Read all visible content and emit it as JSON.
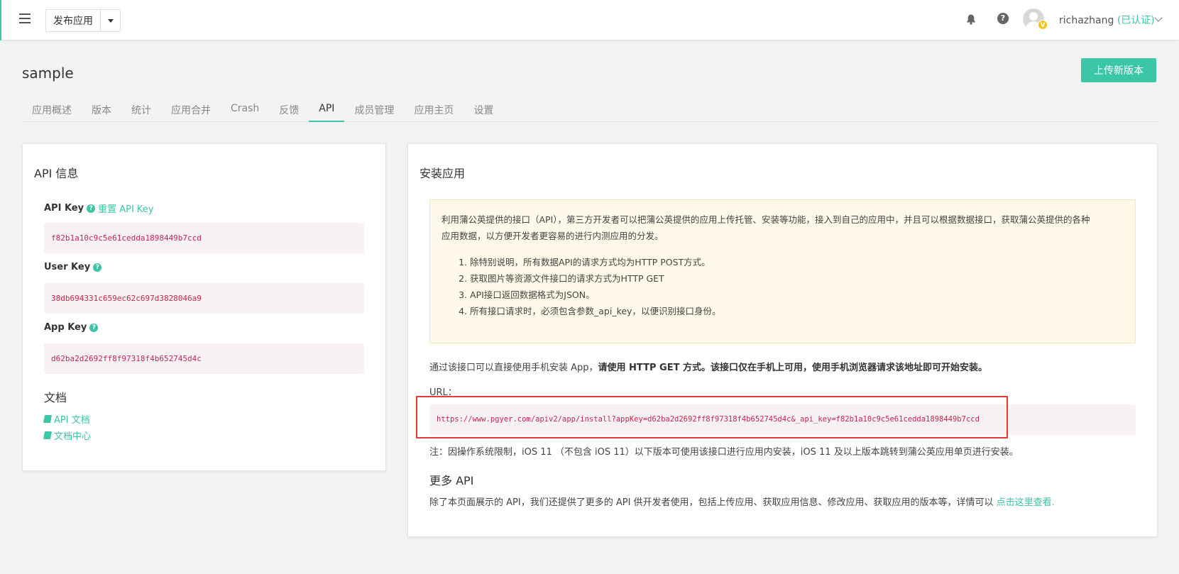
{
  "topbar": {
    "app_select_label": "发布应用",
    "username": "richazhang",
    "verified": "(已认证)",
    "avatar_badge": "V",
    "help_glyph": "?"
  },
  "header": {
    "title": "sample",
    "upload_button": "上传新版本"
  },
  "tabs": [
    {
      "label": "应用概述"
    },
    {
      "label": "版本"
    },
    {
      "label": "统计"
    },
    {
      "label": "应用合并"
    },
    {
      "label": "Crash"
    },
    {
      "label": "反馈"
    },
    {
      "label": "API",
      "active": true
    },
    {
      "label": "成员管理"
    },
    {
      "label": "应用主页"
    },
    {
      "label": "设置"
    }
  ],
  "api_info": {
    "title": "API 信息",
    "api_key_label": "API Key",
    "reset_link": "重置 API Key",
    "api_key_value": "f82b1a10c9c5e61cedda1898449b7ccd",
    "user_key_label": "User Key",
    "user_key_value": "38db694331c659ec62c697d3828046a9",
    "app_key_label": "App Key",
    "app_key_value": "d62ba2d2692ff8f97318f4b652745d4c",
    "docs_title": "文档",
    "doc_link_1": "API 文档",
    "doc_link_2": "文档中心"
  },
  "install": {
    "title": "安装应用",
    "intro_line1": "利用蒲公英提供的接口（API），第三方开发者可以把蒲公英提供的应用上传托管、安装等功能，接入到自己的应用中，并且可以根据数据接口，获取蒲公英提供的各种",
    "intro_line2": "应用数据，以方便开发者更容易的进行内测应用的分发。",
    "rules": [
      "除特别说明，所有数据API的请求方式均为HTTP POST方式。",
      "获取图片等资源文件接口的请求方式为HTTP GET",
      "API接口返回数据格式为JSON。",
      "所有接口请求时，必须包含参数_api_key，以便识别接口身份。"
    ],
    "desc_normal": "通过该接口可以直接使用手机安装 App，",
    "desc_bold": "请使用 HTTP GET 方式。该接口仅在手机上可用，使用手机浏览器请求该地址即可开始安装。",
    "url_label": "URL：",
    "url_value": "https://www.pgyer.com/apiv2/app/install?appKey=d62ba2d2692ff8f97318f4b652745d4c&_api_key=f82b1a10c9c5e61cedda1898449b7ccd",
    "note": "注：因操作系统限制，iOS 11 （不包含 iOS 11）以下版本可使用该接口进行应用内安装，iOS 11 及以上版本跳转到蒲公英应用单页进行安装。",
    "more_title": "更多 API",
    "more_desc": "除了本页面展示的 API，我们还提供了更多的 API 供开发者使用，包括上传应用、获取应用信息、修改应用、获取应用的版本等，详情可以 ",
    "more_link": "点击这里查看."
  },
  "colors": {
    "accent": "#3cc6a8",
    "code_text": "#c7254e",
    "highlight": "#e53935"
  }
}
